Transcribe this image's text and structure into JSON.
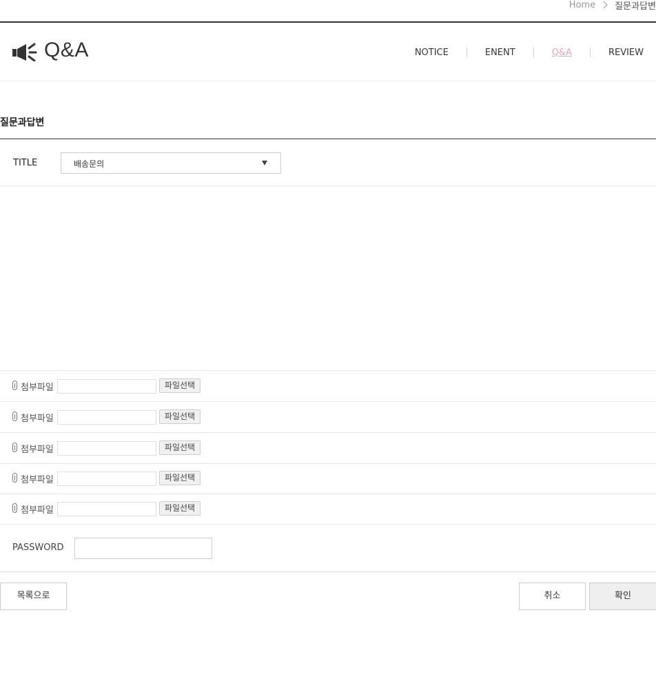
{
  "breadcrumb": {
    "home": "Home",
    "current": "질문과답변"
  },
  "header": {
    "title": "Q&A",
    "nav": [
      {
        "label": "NOTICE",
        "active": false
      },
      {
        "label": "ENENT",
        "active": false
      },
      {
        "label": "Q&A",
        "active": true
      },
      {
        "label": "REVIEW",
        "active": false
      }
    ],
    "active_color": "#e8a5b8"
  },
  "section": {
    "title": "질문과답변"
  },
  "form": {
    "title_label": "TITLE",
    "title_selected": "배송문의",
    "attachments": [
      {
        "label": "첨부파일",
        "button": "파일선택"
      },
      {
        "label": "첨부파일",
        "button": "파일선택"
      },
      {
        "label": "첨부파일",
        "button": "파일선택"
      },
      {
        "label": "첨부파일",
        "button": "파일선택"
      },
      {
        "label": "첨부파일",
        "button": "파일선택"
      }
    ],
    "password_label": "PASSWORD"
  },
  "buttons": {
    "list": "목록으로",
    "cancel": "취소",
    "confirm": "확인"
  }
}
